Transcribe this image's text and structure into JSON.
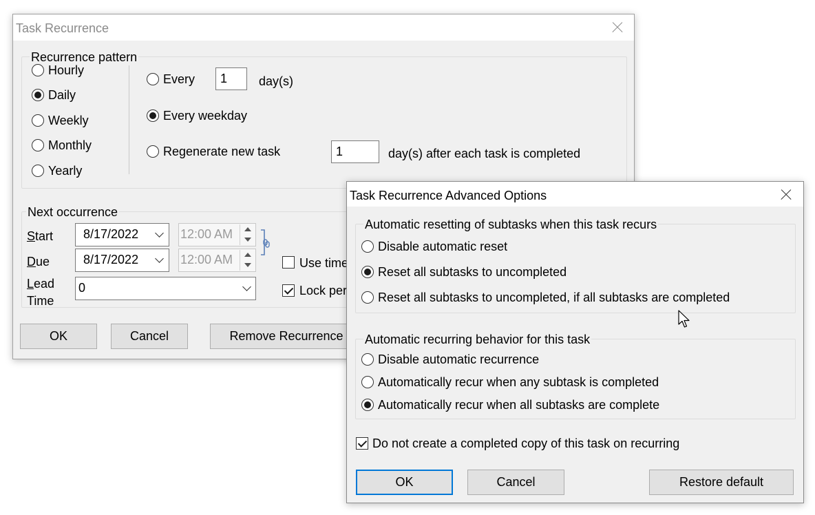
{
  "main_dialog": {
    "title": "Task Recurrence",
    "pattern_group": {
      "legend": "Recurrence pattern",
      "types": [
        "Hourly",
        "Daily",
        "Weekly",
        "Monthly",
        "Yearly"
      ],
      "selected_type": "Daily",
      "options": {
        "every_label": "Every",
        "every_value": "1",
        "every_unit": "day(s)",
        "every_weekday_label": "Every weekday",
        "regenerate_label": "Regenerate new task",
        "regenerate_value": "1",
        "regenerate_unit": "day(s) after each task is completed",
        "selected": "Every weekday"
      }
    },
    "next_group": {
      "legend": "Next occurrence",
      "start_label_u": "S",
      "start_label_rest": "tart",
      "start_date": "8/17/2022",
      "start_time": "12:00 AM",
      "due_label_u": "D",
      "due_label_rest": "ue",
      "due_date": "8/17/2022",
      "due_time": "12:00 AM",
      "lead_label_u": "L",
      "lead_label_line1_rest": "ead",
      "lead_label_line2": "Time",
      "lead_value": "0",
      "use_time_label": "Use time",
      "use_time_checked": false,
      "lock_label": "Lock peri",
      "lock_checked": true
    },
    "buttons": {
      "ok": "OK",
      "cancel": "Cancel",
      "remove": "Remove Recurrence"
    }
  },
  "advanced_dialog": {
    "title": "Task Recurrence Advanced Options",
    "reset_group": {
      "legend": "Automatic resetting of subtasks when this task recurs",
      "options": [
        "Disable automatic reset",
        "Reset all subtasks to uncompleted",
        "Reset all subtasks to uncompleted, if all subtasks are completed"
      ],
      "selected_index": 1
    },
    "recur_group": {
      "legend": "Automatic recurring behavior for this task",
      "options": [
        "Disable automatic recurrence",
        "Automatically recur when any subtask is completed",
        "Automatically recur when all subtasks are complete"
      ],
      "selected_index": 2
    },
    "no_copy_label": "Do not create a completed copy of this task on recurring",
    "no_copy_checked": true,
    "buttons": {
      "ok": "OK",
      "cancel": "Cancel",
      "restore": "Restore default"
    }
  },
  "colors": {
    "dialog_bg": "#f0f0f0",
    "accent": "#0078d7",
    "link_icon": "#5a7fb8"
  }
}
